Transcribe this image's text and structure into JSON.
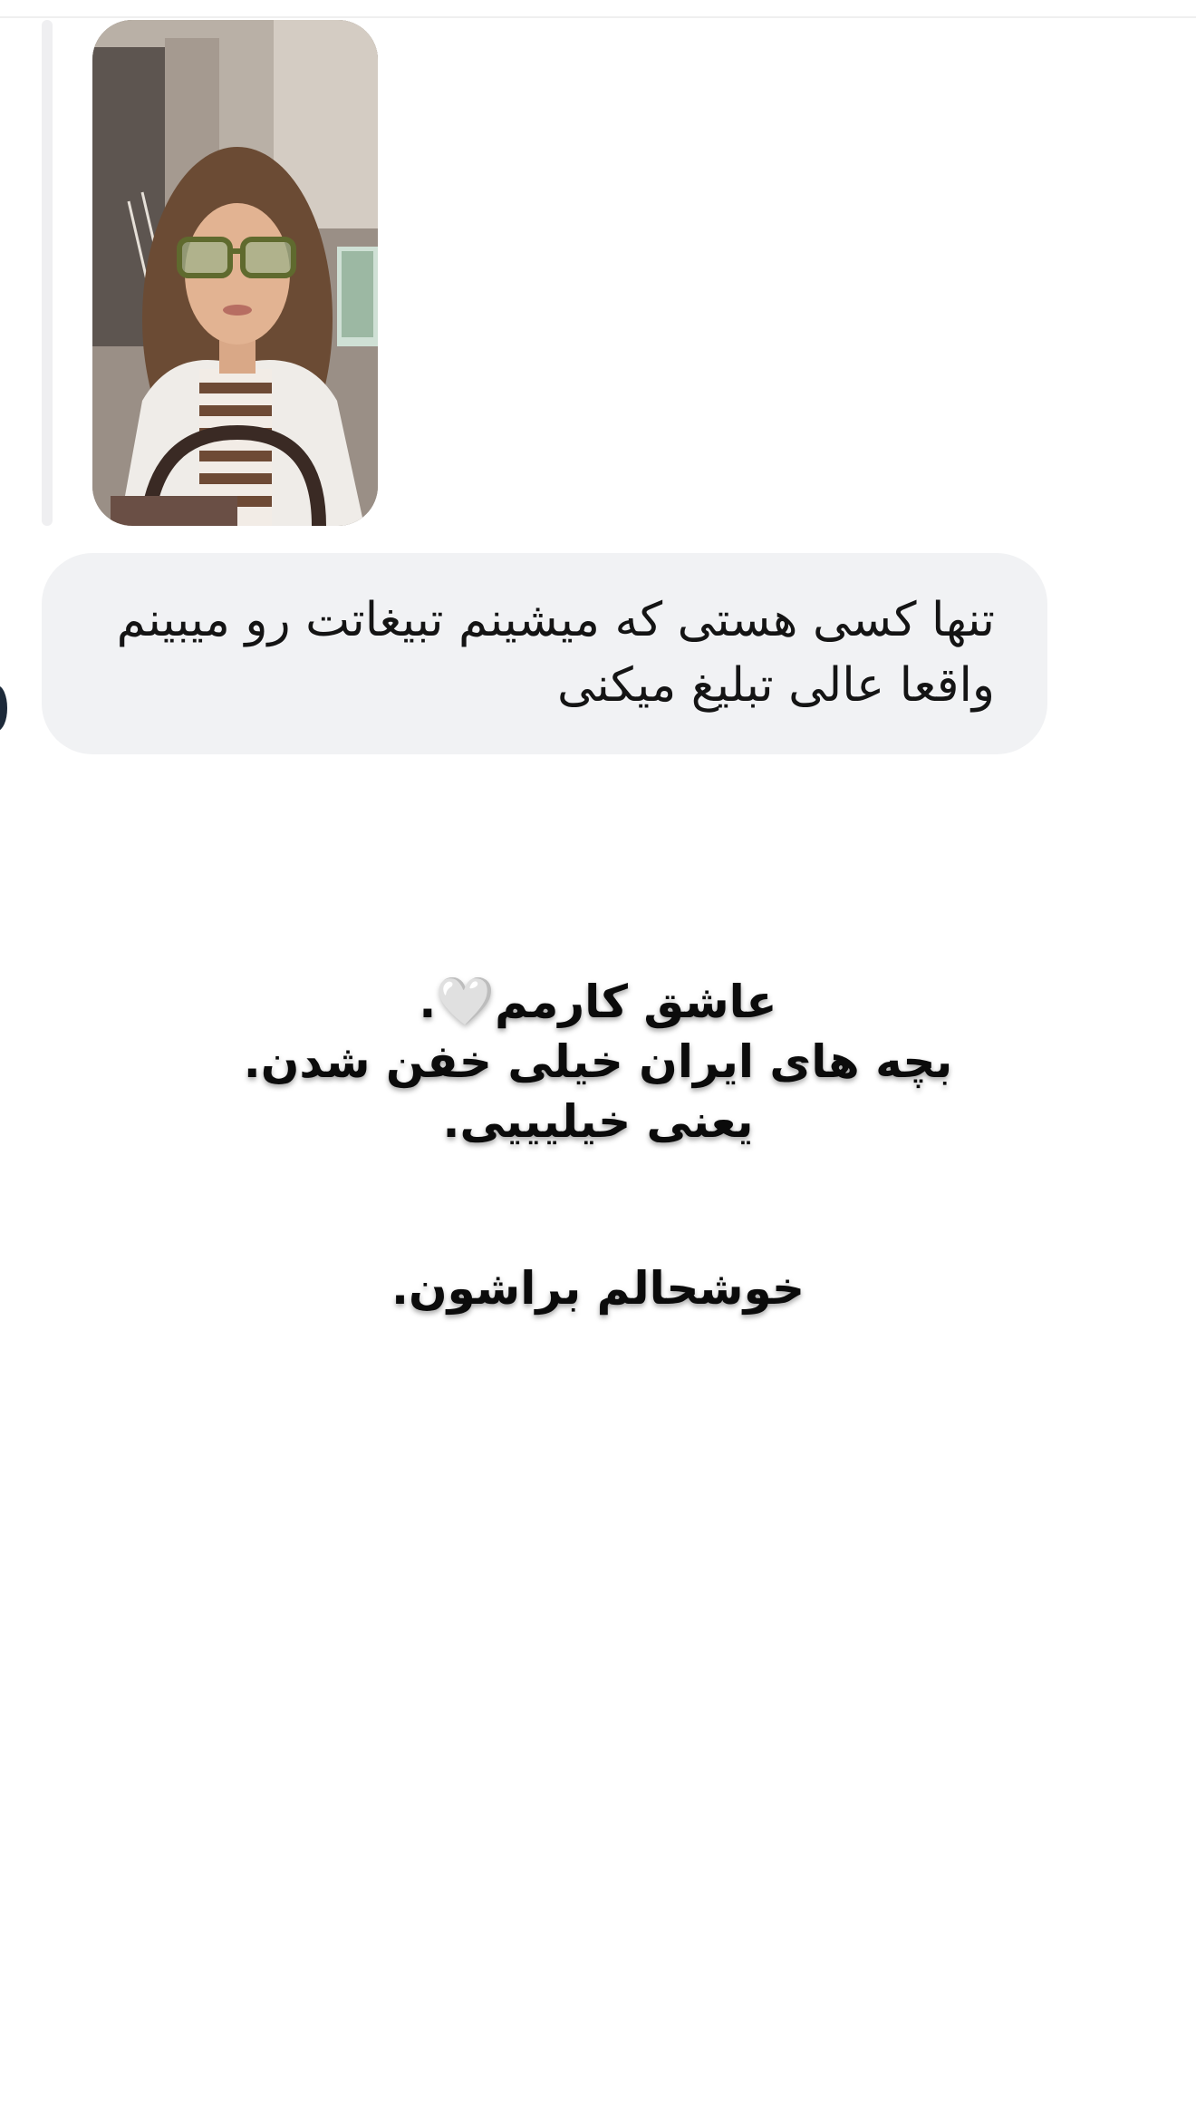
{
  "story_reply": {
    "thumbnail_icon": "story-video-thumbnail"
  },
  "message": {
    "line1": "تنها کسی هستی که میشینم تبیغاتت رو میبینم",
    "line2": "واقعا عالی تبلیغ میکنی"
  },
  "caption": {
    "line1_text": "عاشق کارمم",
    "line1_heart": "🤍",
    "line1_end": ".",
    "line2": "بچه های ایران خیلی خفن شدن.",
    "line3": "یعنی خیلیییی.",
    "line4": "خوشحالم براشون."
  },
  "colors": {
    "bubble_bg": "#f1f2f4",
    "text": "#141414",
    "reply_bar": "#efeff1"
  }
}
